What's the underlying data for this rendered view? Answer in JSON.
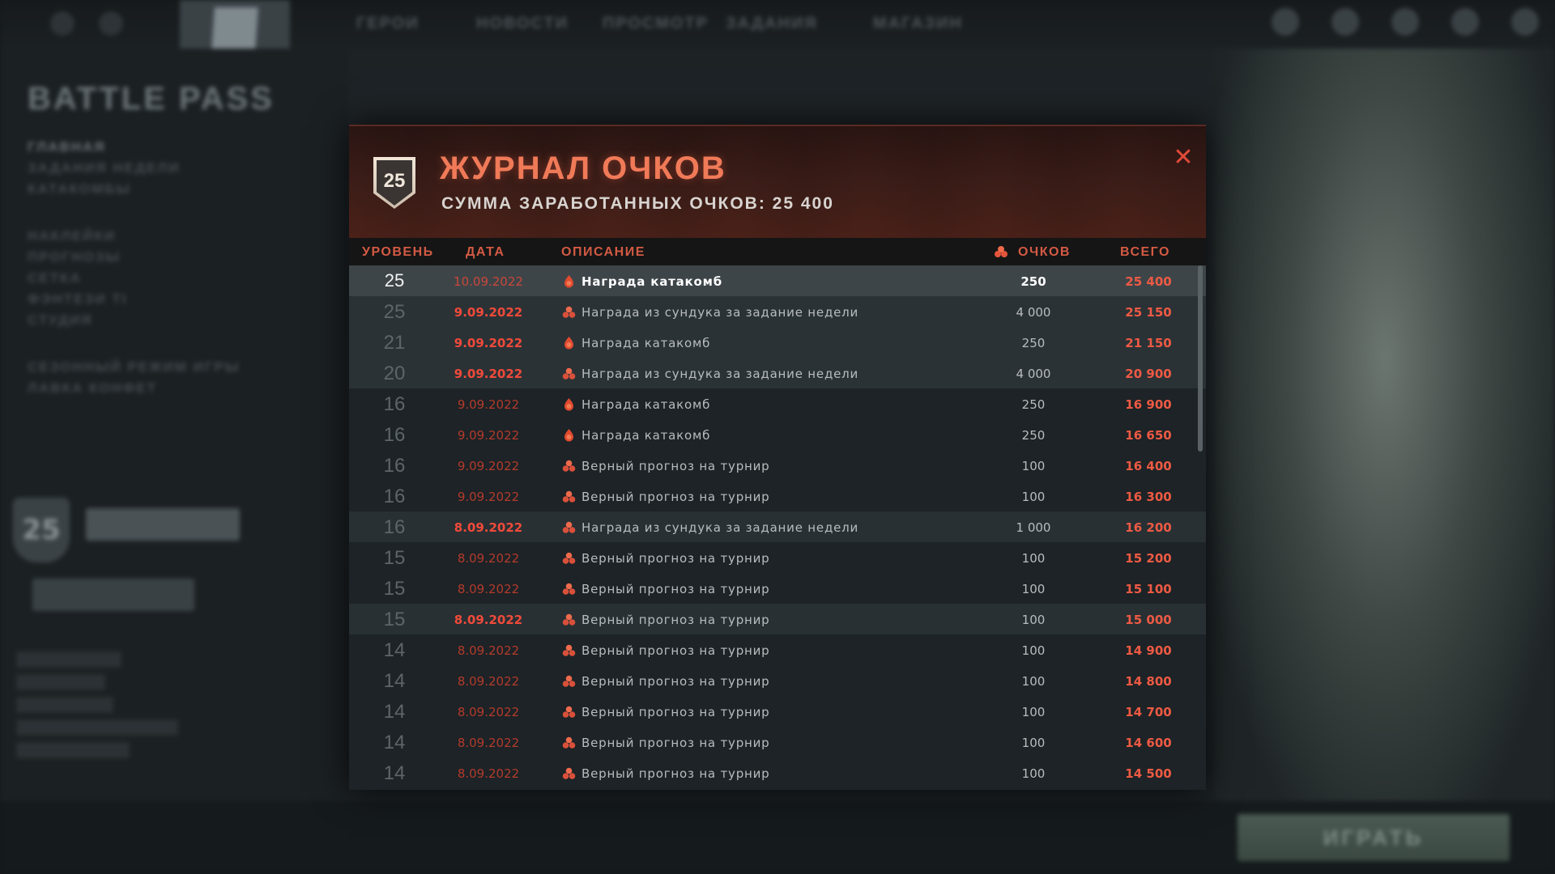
{
  "background": {
    "topbar": {
      "nav": [
        "ГЕРОИ",
        "НОВОСТИ",
        "ПРОСМОТР",
        "ЗАДАНИЯ",
        "МАГАЗИН"
      ]
    },
    "sidebar": {
      "logo": "BATTLE PASS",
      "items": [
        "ГЛАВНАЯ",
        "ЗАДАНИЯ НЕДЕЛИ",
        "КАТАКОМБЫ",
        "НАКЛЕЙКИ",
        "ПРОГНОЗЫ",
        "СЕТКА",
        "ФЭНТЕЗИ TI",
        "СТУДИЯ",
        "СЕЗОННЫЙ РЕЖИМ ИГРЫ",
        "ЛАВКА КОНФЕТ"
      ],
      "level": "25"
    },
    "play_button": "ИГРАТЬ"
  },
  "modal": {
    "level_badge": "25",
    "title": "Журнал очков",
    "subtitle": "Сумма заработанных очков: 25 400",
    "close_icon": "close-icon",
    "columns": {
      "level": "Уровень",
      "date": "Дата",
      "description": "Описание",
      "points": "Очков",
      "total": "Всего"
    },
    "accent_color": "#ee5a44",
    "rows": [
      {
        "level": "25",
        "date": "10.09.2022",
        "icon": "catacomb-drop-icon",
        "description": "Награда катакомб",
        "points": "250",
        "total": "25 400",
        "style": "hl1"
      },
      {
        "level": "25",
        "date": "9.09.2022",
        "icon": "chest-pile-icon",
        "description": "Награда из сундука за задание недели",
        "points": "4 000",
        "total": "25 150",
        "style": "hl2"
      },
      {
        "level": "21",
        "date": "9.09.2022",
        "icon": "catacomb-drop-icon",
        "description": "Награда катакомб",
        "points": "250",
        "total": "21 150",
        "style": "hl2"
      },
      {
        "level": "20",
        "date": "9.09.2022",
        "icon": "chest-pile-icon",
        "description": "Награда из сундука за задание недели",
        "points": "4 000",
        "total": "20 900",
        "style": "hl2"
      },
      {
        "level": "16",
        "date": "9.09.2022",
        "icon": "catacomb-drop-icon",
        "description": "Награда катакомб",
        "points": "250",
        "total": "16 900",
        "style": "dark"
      },
      {
        "level": "16",
        "date": "9.09.2022",
        "icon": "catacomb-drop-icon",
        "description": "Награда катакомб",
        "points": "250",
        "total": "16 650",
        "style": "dark"
      },
      {
        "level": "16",
        "date": "9.09.2022",
        "icon": "chest-pile-icon",
        "description": "Верный прогноз на турнир",
        "points": "100",
        "total": "16 400",
        "style": "dark"
      },
      {
        "level": "16",
        "date": "9.09.2022",
        "icon": "chest-pile-icon",
        "description": "Верный прогноз на турнир",
        "points": "100",
        "total": "16 300",
        "style": "dark"
      },
      {
        "level": "16",
        "date": "8.09.2022",
        "icon": "chest-pile-icon",
        "description": "Награда из сундука за задание недели",
        "points": "1 000",
        "total": "16 200",
        "style": "band"
      },
      {
        "level": "15",
        "date": "8.09.2022",
        "icon": "chest-pile-icon",
        "description": "Верный прогноз на турнир",
        "points": "100",
        "total": "15 200",
        "style": "dark"
      },
      {
        "level": "15",
        "date": "8.09.2022",
        "icon": "chest-pile-icon",
        "description": "Верный прогноз на турнир",
        "points": "100",
        "total": "15 100",
        "style": "dark"
      },
      {
        "level": "15",
        "date": "8.09.2022",
        "icon": "chest-pile-icon",
        "description": "Верный прогноз на турнир",
        "points": "100",
        "total": "15 000",
        "style": "band"
      },
      {
        "level": "14",
        "date": "8.09.2022",
        "icon": "chest-pile-icon",
        "description": "Верный прогноз на турнир",
        "points": "100",
        "total": "14 900",
        "style": "dark"
      },
      {
        "level": "14",
        "date": "8.09.2022",
        "icon": "chest-pile-icon",
        "description": "Верный прогноз на турнир",
        "points": "100",
        "total": "14 800",
        "style": "dark"
      },
      {
        "level": "14",
        "date": "8.09.2022",
        "icon": "chest-pile-icon",
        "description": "Верный прогноз на турнир",
        "points": "100",
        "total": "14 700",
        "style": "dark"
      },
      {
        "level": "14",
        "date": "8.09.2022",
        "icon": "chest-pile-icon",
        "description": "Верный прогноз на турнир",
        "points": "100",
        "total": "14 600",
        "style": "dark"
      },
      {
        "level": "14",
        "date": "8.09.2022",
        "icon": "chest-pile-icon",
        "description": "Верный прогноз на турнир",
        "points": "100",
        "total": "14 500",
        "style": "dark"
      }
    ]
  }
}
